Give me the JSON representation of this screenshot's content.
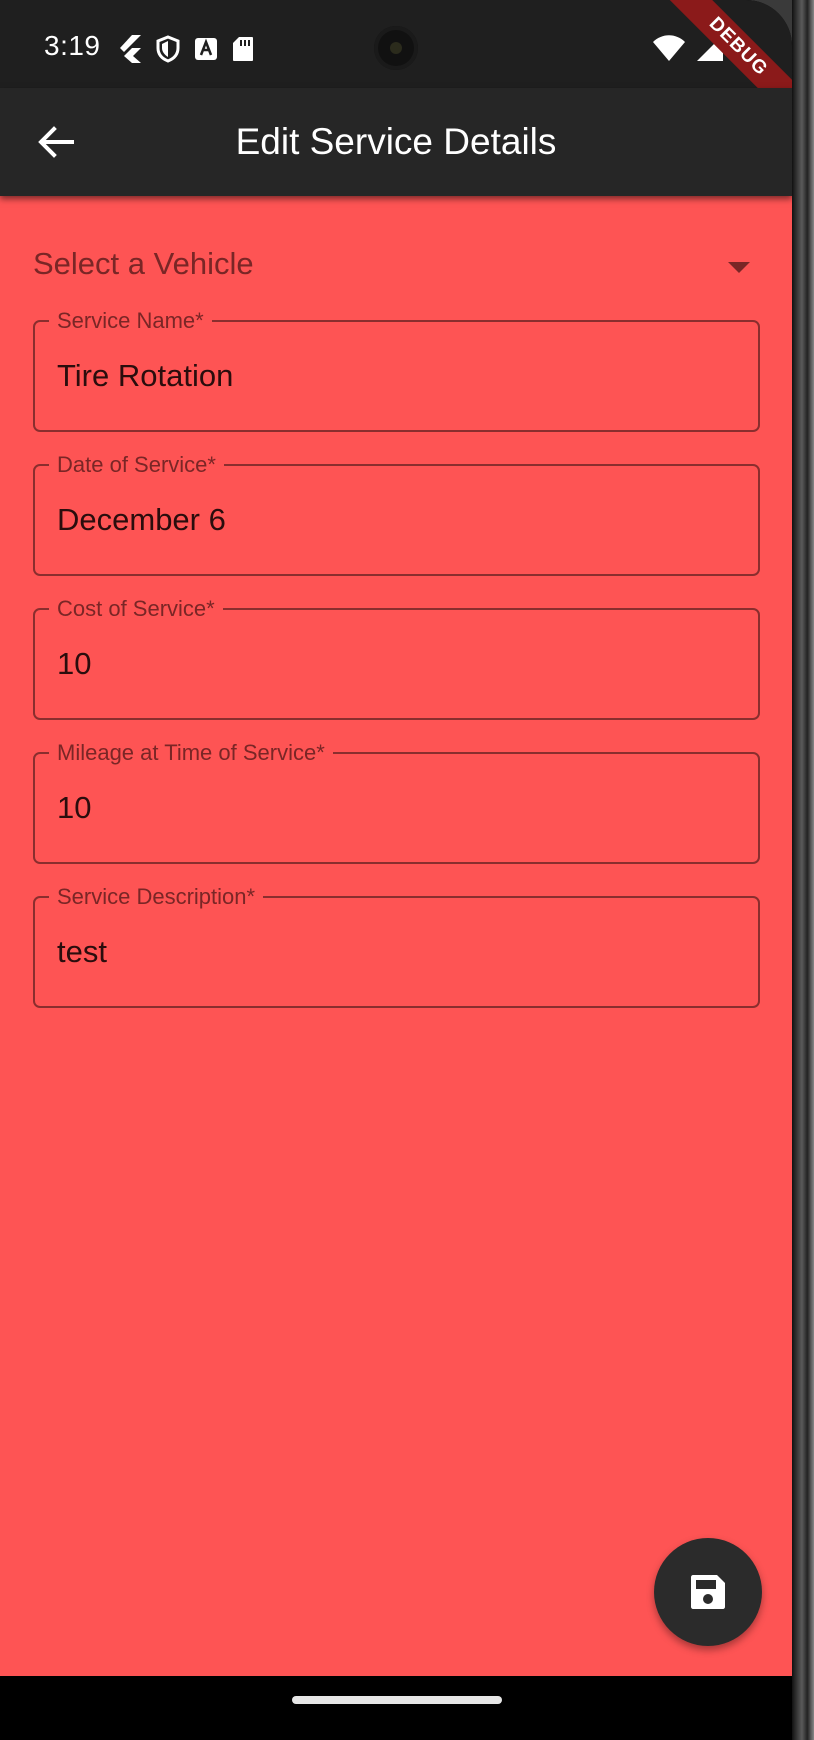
{
  "status_bar": {
    "time": "3:19",
    "icons_left": [
      "flutter-icon",
      "shield-icon",
      "text-a-icon",
      "sd-card-icon"
    ],
    "icons_right": [
      "wifi-icon",
      "signal-icon"
    ],
    "debug_banner": "DEBUG"
  },
  "app_bar": {
    "back_icon": "arrow-left-icon",
    "title": "Edit Service Details"
  },
  "form": {
    "vehicle_select": {
      "placeholder": "Select a Vehicle",
      "icon": "dropdown-arrow-icon"
    },
    "fields": [
      {
        "label": "Service Name*",
        "value": "Tire Rotation"
      },
      {
        "label": "Date of Service*",
        "value": "December 6"
      },
      {
        "label": "Cost of Service*",
        "value": "10"
      },
      {
        "label": "Mileage at Time of Service*",
        "value": "10"
      },
      {
        "label": "Service Description*",
        "value": "test"
      }
    ]
  },
  "fab": {
    "icon": "save-icon"
  },
  "colors": {
    "background": "#fe5454",
    "app_bar": "#262626",
    "fab": "#2b2b2b",
    "field_border": "#8a2e2e",
    "debug_ribbon": "#8b1a1a"
  }
}
